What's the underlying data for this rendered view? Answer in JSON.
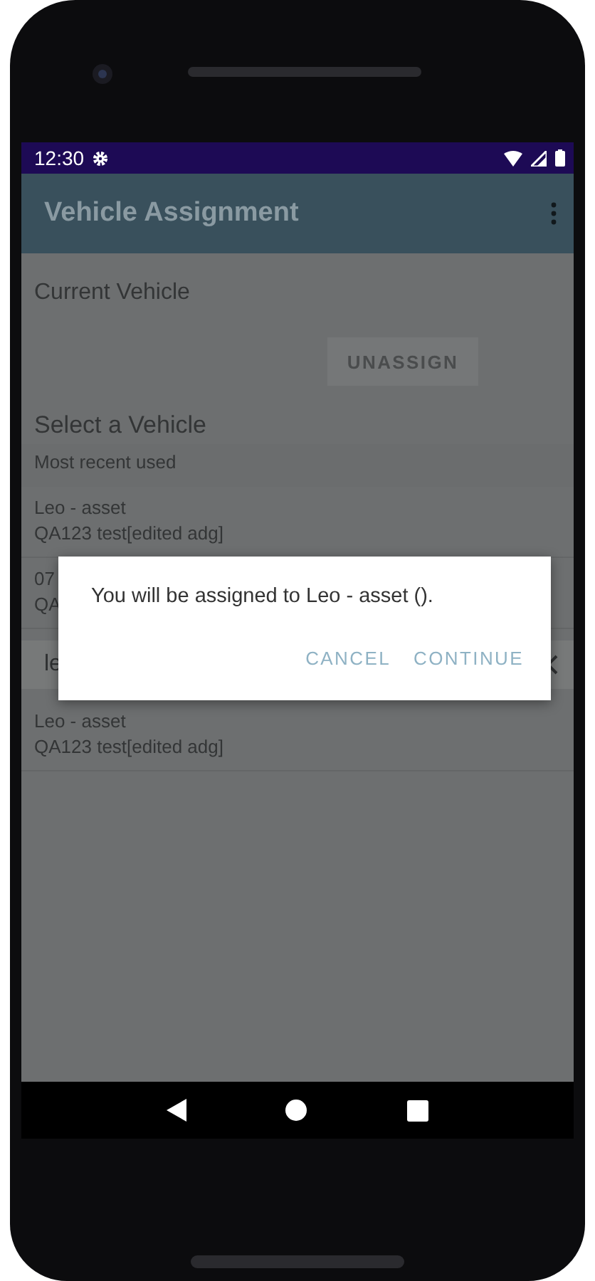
{
  "status_bar": {
    "time": "12:30"
  },
  "app_bar": {
    "title": "Vehicle Assignment"
  },
  "current_vehicle": {
    "heading": "Current Vehicle",
    "button": "UNASSIGN"
  },
  "select": {
    "heading": "Select a Vehicle",
    "recent_label": "Most recent used"
  },
  "recent": [
    {
      "name": "Leo - asset",
      "detail": "QA123 test[edited adg]"
    },
    {
      "name": "07",
      "detail": "QA"
    }
  ],
  "search": {
    "value": "le"
  },
  "results": [
    {
      "name": "Leo - asset",
      "detail": "QA123 test[edited adg]"
    }
  ],
  "dialog": {
    "message": "You will be assigned to Leo - asset ().",
    "buttons": [
      "CANCEL",
      "CONTINUE"
    ]
  }
}
